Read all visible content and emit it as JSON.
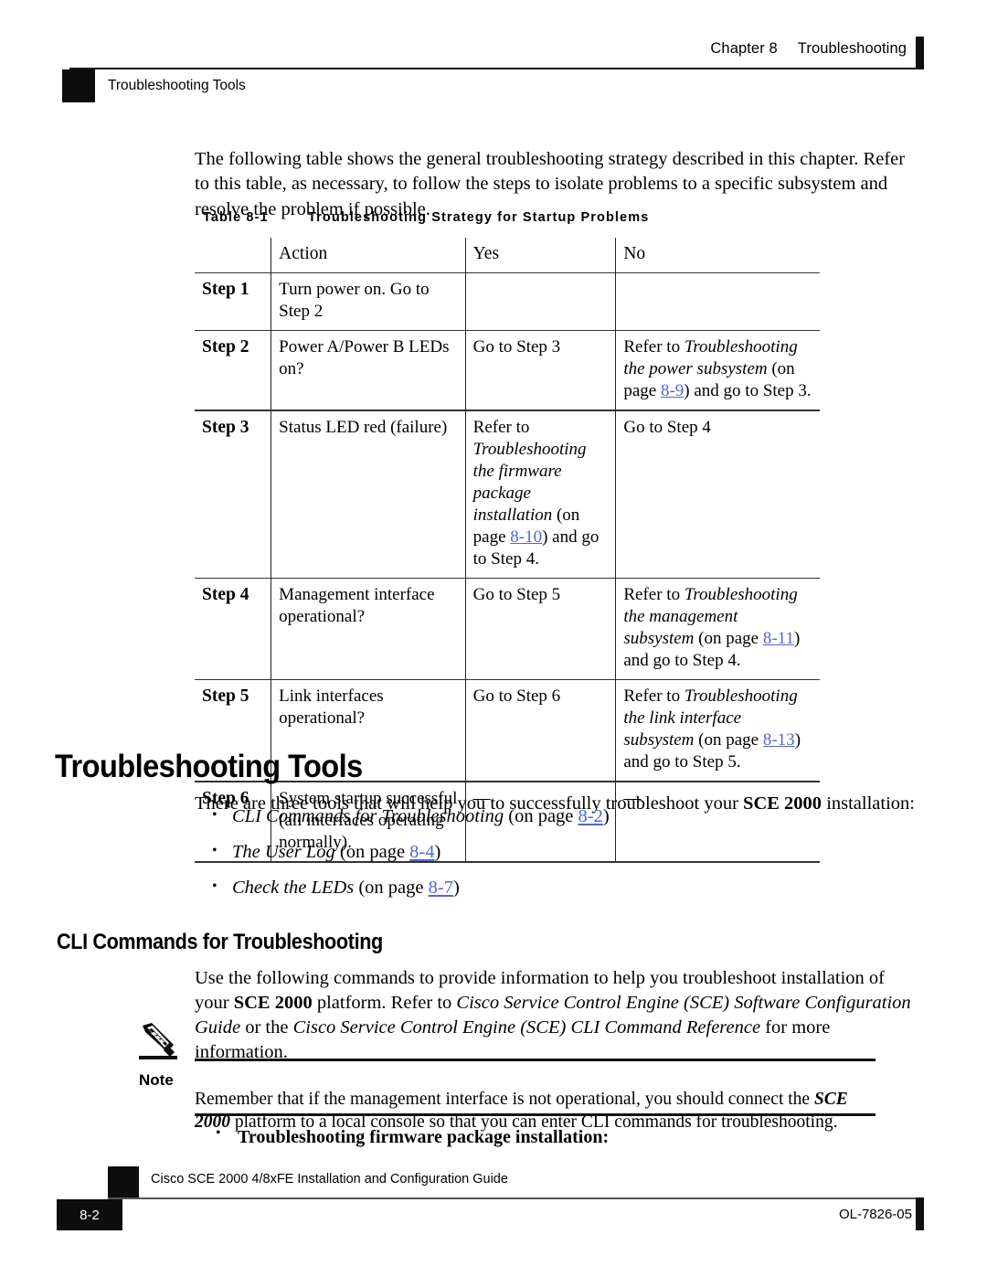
{
  "header": {
    "chapter": "Chapter 8",
    "chapter_title": "Troubleshooting",
    "running_section": "Troubleshooting Tools"
  },
  "intro_paragraph": "The following table shows the general troubleshooting strategy described in this chapter. Refer to this table, as necessary, to follow the steps to isolate problems to a specific subsystem and resolve the problem if possible.",
  "table": {
    "caption_number": "Table 8-1",
    "caption_title": "Troubleshooting Strategy for Startup Problems",
    "columns": [
      "",
      "Action",
      "Yes",
      "No"
    ],
    "rows": [
      {
        "step": "Step 1",
        "action": "Turn power on. Go to Step 2",
        "yes": {
          "pre": "",
          "italic": "",
          "post": "",
          "page": "",
          "tail": ""
        },
        "no": {
          "pre": "",
          "italic": "",
          "post": "",
          "page": "",
          "tail": ""
        }
      },
      {
        "step": "Step 2",
        "action": "Power A/Power B LEDs on?",
        "yes": {
          "pre": "Go to Step 3",
          "italic": "",
          "post": "",
          "page": "",
          "tail": ""
        },
        "no": {
          "pre": "Refer to ",
          "italic": "Troubleshooting the power subsystem",
          "post": " (on page ",
          "page": "8-9",
          "tail": ") and go to Step 3."
        }
      },
      {
        "step": "Step 3",
        "action": "Status LED red (failure)",
        "yes": {
          "pre": "Refer to ",
          "italic": "Troubleshooting the firmware package installation",
          "post": " (on page ",
          "page": "8-10",
          "tail": ") and go to Step 4."
        },
        "no": {
          "pre": "Go to Step 4",
          "italic": "",
          "post": "",
          "page": "",
          "tail": ""
        }
      },
      {
        "step": "Step 4",
        "action": "Management interface operational?",
        "yes": {
          "pre": "Go to Step 5",
          "italic": "",
          "post": "",
          "page": "",
          "tail": ""
        },
        "no": {
          "pre": "Refer to ",
          "italic": "Troubleshooting the management subsystem",
          "post": " (on page ",
          "page": "8-11",
          "tail": ") and go to Step 4."
        }
      },
      {
        "step": "Step 5",
        "action": "Link interfaces operational?",
        "yes": {
          "pre": "Go to Step 6",
          "italic": "",
          "post": "",
          "page": "",
          "tail": ""
        },
        "no": {
          "pre": "Refer to ",
          "italic": "Troubleshooting the link interface subsystem",
          "post": " (on page ",
          "page": "8-13",
          "tail": ") and go to Step 5."
        }
      },
      {
        "step": "Step 6",
        "action": "System startup successful (all interfaces operating normally).",
        "yes": {
          "pre": "—",
          "italic": "",
          "post": "",
          "page": "",
          "tail": ""
        },
        "no": {
          "pre": "—",
          "italic": "",
          "post": "",
          "page": "",
          "tail": ""
        }
      }
    ]
  },
  "tools_section": {
    "heading": "Troubleshooting Tools",
    "intro_pre": "There are three tools that will help you to successfully troubleshoot your ",
    "intro_bold": "SCE 2000",
    "intro_post": " installation:",
    "bullets": [
      {
        "italic": "CLI Commands for Troubleshooting",
        "post": " (on page ",
        "page": "8-2",
        "tail": ")"
      },
      {
        "italic": "The User Log",
        "post": " (on page ",
        "page": "8-4",
        "tail": ")"
      },
      {
        "italic": "Check the LEDs",
        "post": " (on page ",
        "page": "8-7",
        "tail": ")"
      }
    ]
  },
  "cli_section": {
    "heading": "CLI Commands for Troubleshooting",
    "para_1": "Use the following commands to provide information to help you troubleshoot installation of your ",
    "para_bold_1": "SCE 2000",
    "para_2": " platform. Refer to ",
    "para_ital_1": "Cisco Service Control Engine (SCE) Software Configuration Guide",
    "para_3": " or the ",
    "para_ital_2": "Cisco Service Control Engine (SCE) CLI Command Reference",
    "para_4": " for more information."
  },
  "note": {
    "label": "Note",
    "text_1": "Remember that if the management interface is not operational, you should connect the ",
    "text_bold": "SCE 2000",
    "text_2": " platform to a local console so that you can enter CLI commands for troubleshooting."
  },
  "final_bullet": "Troubleshooting firmware package installation:",
  "footer": {
    "guide_title": "Cisco SCE 2000 4/8xFE Installation and Configuration Guide",
    "page_number": "8-2",
    "doc_id": "OL-7826-05"
  },
  "colors": {
    "xref_blue": "#5566cc",
    "rule_black": "#111111",
    "text_black": "#000000"
  }
}
